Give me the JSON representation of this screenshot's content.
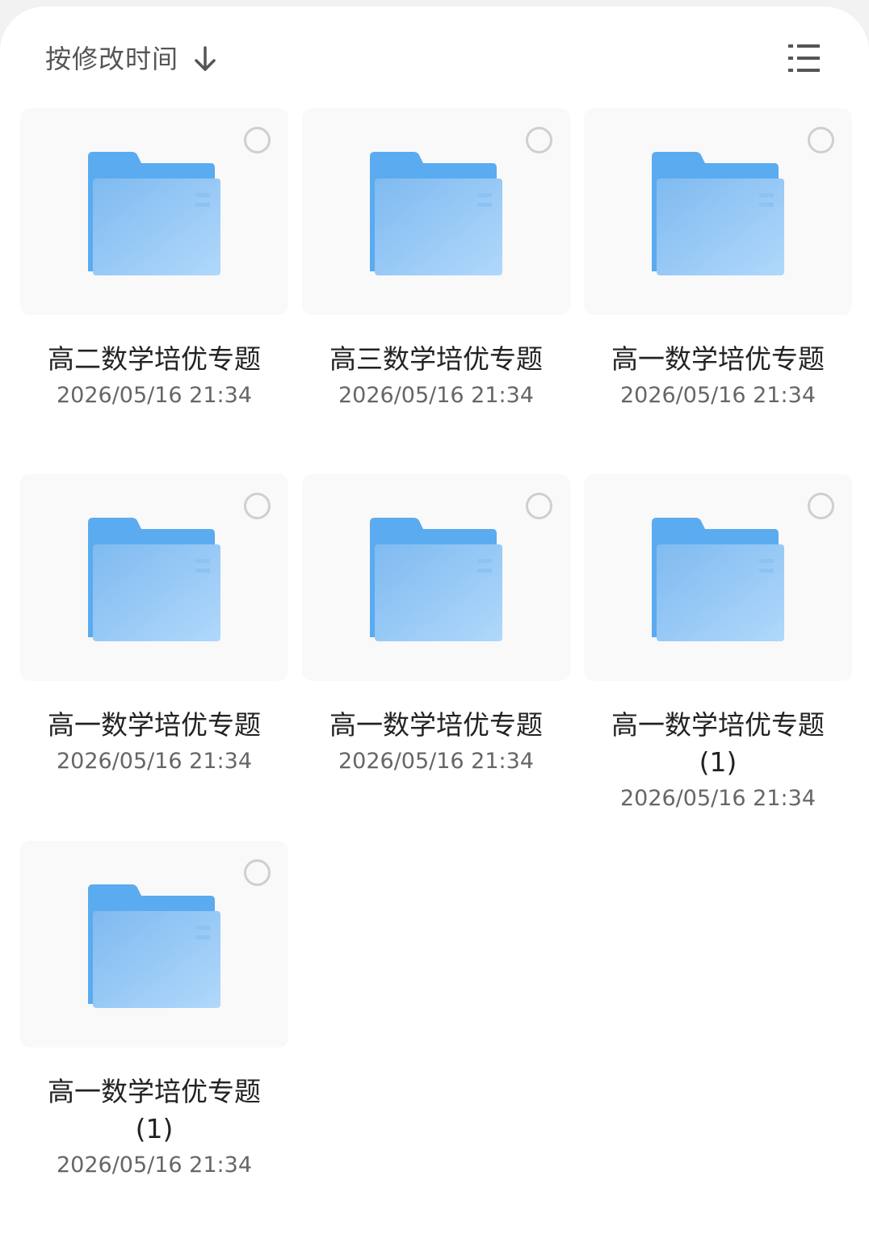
{
  "toolbar": {
    "sort_label": "按修改时间",
    "sort_icon": "arrow-down-icon",
    "view_icon": "list-view-icon"
  },
  "colors": {
    "folder_back": "#5aabf0",
    "folder_front": "#9ccbf5",
    "thumb_bg": "#f9f9f9",
    "check_border": "#cfcfcf"
  },
  "folders": [
    {
      "name": "高二数学培优专题",
      "date": "2026/05/16 21:34"
    },
    {
      "name": "高三数学培优专题",
      "date": "2026/05/16 21:34"
    },
    {
      "name": "高一数学培优专题",
      "date": "2026/05/16 21:34"
    },
    {
      "name": "高一数学培优专题",
      "date": "2026/05/16 21:34"
    },
    {
      "name": "高一数学培优专题",
      "date": "2026/05/16 21:34"
    },
    {
      "name": "高一数学培优专题(1)",
      "date": "2026/05/16 21:34"
    },
    {
      "name": "高一数学培优专题(1)",
      "date": "2026/05/16 21:34"
    }
  ]
}
